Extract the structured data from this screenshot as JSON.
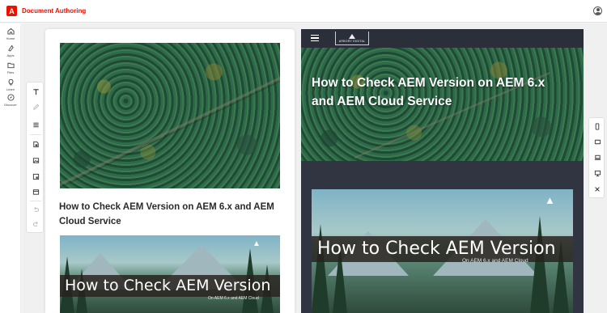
{
  "app": {
    "title": "Document Authoring",
    "logo_letter": "A",
    "brand_color": "#eb1000"
  },
  "rail": [
    {
      "label": "Home",
      "icon": "home-icon"
    },
    {
      "label": "Apps",
      "icon": "apps-icon"
    },
    {
      "label": "Files",
      "icon": "folder-icon"
    },
    {
      "label": "Learn",
      "icon": "lightbulb-icon"
    },
    {
      "label": "Discover",
      "icon": "compass-icon"
    }
  ],
  "toolbar": {
    "tools": [
      "text-icon",
      "pen-icon",
      "list-icon",
      "fragment-icon",
      "image-icon",
      "gallery-icon",
      "table-icon",
      "undo-icon",
      "redo-icon"
    ]
  },
  "device_toolbar": [
    "mobile-icon",
    "tablet-icon",
    "laptop-icon",
    "desktop-icon",
    "close-icon"
  ],
  "document": {
    "heading": "How to Check AEM Version on AEM 6.x and AEM Cloud Service",
    "thumbnail_title": "How to Check AEM Version",
    "thumbnail_subtitle": "On AEM 6.x and AEM Cloud"
  },
  "preview": {
    "brand": "ARBORY DIGITAL",
    "heading": "How to Check AEM Version on AEM 6.x and AEM Cloud Service",
    "thumbnail_title": "How to Check AEM Version",
    "thumbnail_subtitle": "On AEM 6.x and AEM Cloud",
    "background_color": "#313541"
  }
}
